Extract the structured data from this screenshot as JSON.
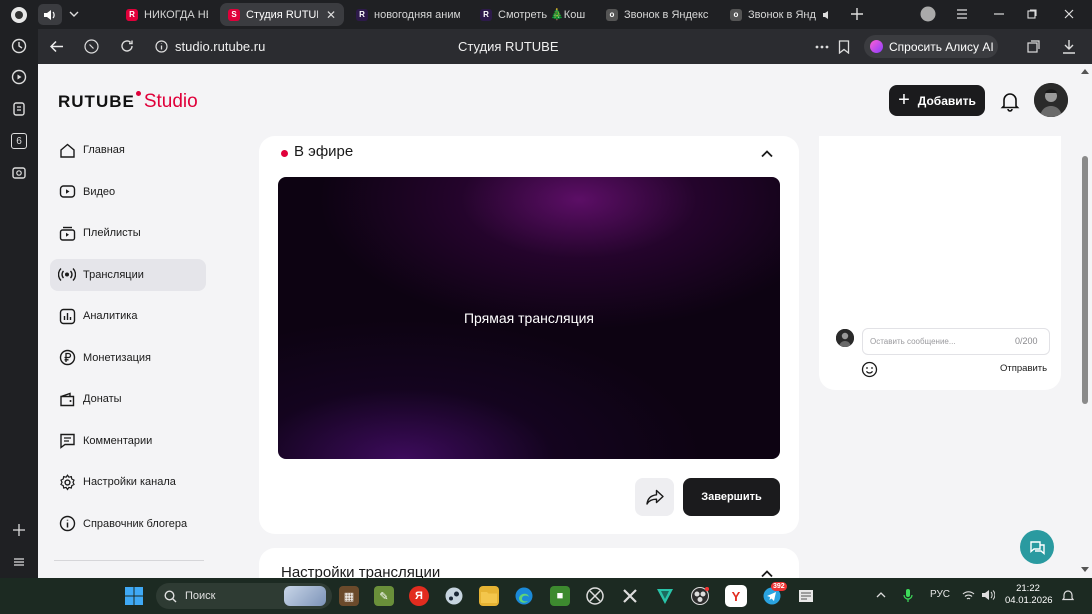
{
  "browser": {
    "tabs": [
      {
        "label": "НИКОГДА НЕ З",
        "fav": "R",
        "fav_color": "#e0003a"
      },
      {
        "label": "Студия RUTUBE",
        "fav": "S",
        "fav_color": "#e0003a",
        "active": true,
        "close": "✕"
      },
      {
        "label": "новогодняя анима",
        "fav": "R",
        "fav_color": "#2d1a4a"
      },
      {
        "label": "Смотреть 🎄Кош",
        "fav": "R",
        "fav_color": "#2d1a4a"
      },
      {
        "label": "Звонок в Яндекс Т",
        "fav": "o",
        "fav_color": "#555"
      },
      {
        "label": "Звонок в Янд",
        "fav": "o",
        "fav_color": "#555"
      }
    ],
    "url": "studio.rutube.ru",
    "page_title": "Студия RUTUBE",
    "alice_label": "Спросить Алису AI",
    "left_badge": "6"
  },
  "header": {
    "logo_main": "RUTUBE",
    "logo_studio": "Studio",
    "add_label": "Добавить"
  },
  "nav": {
    "items": [
      {
        "label": "Главная",
        "icon": "home-icon"
      },
      {
        "label": "Видео",
        "icon": "video-icon"
      },
      {
        "label": "Плейлисты",
        "icon": "playlist-icon"
      },
      {
        "label": "Трансляции",
        "icon": "broadcast-icon",
        "active": true
      },
      {
        "label": "Аналитика",
        "icon": "analytics-icon"
      },
      {
        "label": "Монетизация",
        "icon": "ruble-icon"
      },
      {
        "label": "Донаты",
        "icon": "wallet-icon"
      },
      {
        "label": "Комментарии",
        "icon": "comment-icon"
      },
      {
        "label": "Настройки канала",
        "icon": "gear-icon"
      },
      {
        "label": "Справочник блогера",
        "icon": "info-icon"
      }
    ]
  },
  "stream": {
    "live_title": "В эфире",
    "player_text": "Прямая трансляция",
    "finish_label": "Завершить"
  },
  "settings_card": {
    "title": "Настройки трансляции"
  },
  "chat": {
    "placeholder": "Оставить сообщение...",
    "counter": "0/200",
    "send_label": "Отправить"
  },
  "taskbar": {
    "search_label": "Поиск",
    "language": "РУС",
    "time": "21:22",
    "date": "04.01.2026",
    "badge": "392"
  },
  "colors": {
    "accent": "#e0003a",
    "dark_button": "#1b1b1d",
    "help_button": "#2a9aa0"
  }
}
